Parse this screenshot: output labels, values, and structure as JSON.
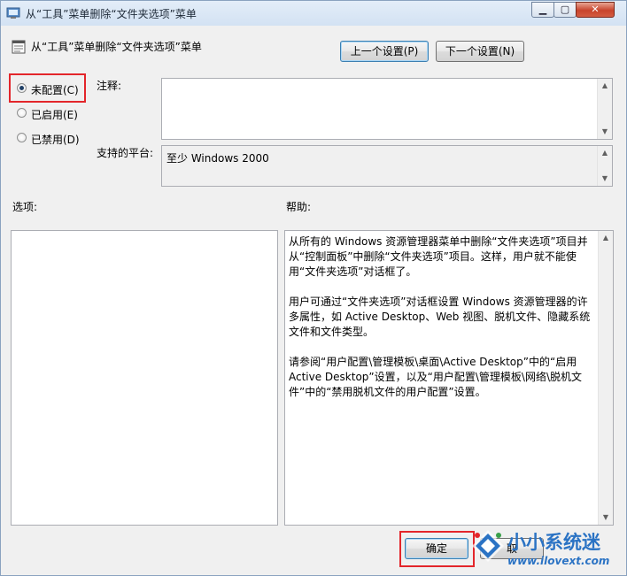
{
  "window": {
    "title": "从“工具”菜单删除“文件夹选项”菜单"
  },
  "caption_buttons": {
    "minimize": "▁",
    "maximize": "▢",
    "close": "✕"
  },
  "header": {
    "policy_title": "从“工具”菜单删除“文件夹选项”菜单",
    "prev_button": "上一个设置(P)",
    "next_button": "下一个设置(N)"
  },
  "state": {
    "options": [
      {
        "label": "未配置(C)",
        "checked": true
      },
      {
        "label": "已启用(E)",
        "checked": false
      },
      {
        "label": "已禁用(D)",
        "checked": false
      }
    ]
  },
  "comment": {
    "label": "注释:",
    "value": ""
  },
  "platform": {
    "label": "支持的平台:",
    "value": "至少 Windows 2000"
  },
  "options_panel": {
    "label": "选项:"
  },
  "help_panel": {
    "label": "帮助:",
    "paragraphs": [
      "从所有的 Windows 资源管理器菜单中删除“文件夹选项”项目并从“控制面板”中删除“文件夹选项”项目。这样，用户就不能使用“文件夹选项”对话框了。",
      "用户可通过“文件夹选项”对话框设置 Windows 资源管理器的许多属性，如 Active Desktop、Web 视图、脱机文件、隐藏系统文件和文件类型。",
      "请参阅“用户配置\\管理模板\\桌面\\Active Desktop”中的“启用 Active Desktop”设置，以及“用户配置\\管理模板\\网络\\脱机文件”中的“禁用脱机文件的用户配置”设置。"
    ]
  },
  "footer": {
    "ok_button": "确定",
    "cancel_button": "取"
  },
  "watermark": {
    "name": "小小系统迷",
    "url": "www.ilovext.com"
  },
  "colors": {
    "highlight": "#e3262b",
    "accent": "#2b73c4"
  }
}
